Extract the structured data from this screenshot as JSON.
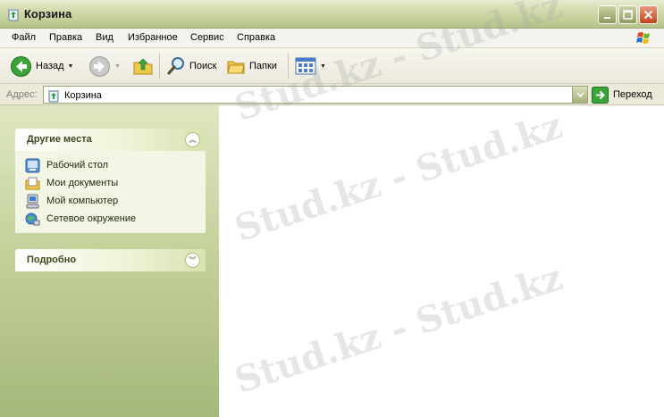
{
  "window": {
    "title": "Корзина",
    "accent_color": "#b5c28a"
  },
  "menu": {
    "items": [
      "Файл",
      "Правка",
      "Вид",
      "Избранное",
      "Сервис",
      "Справка"
    ]
  },
  "toolbar": {
    "back_label": "Назад",
    "search_label": "Поиск",
    "folders_label": "Папки"
  },
  "address": {
    "label": "Адрес:",
    "value": "Корзина",
    "go_label": "Переход"
  },
  "taskpane": {
    "other_places": {
      "title": "Другие места",
      "items": [
        {
          "label": "Рабочий стол",
          "icon": "desktop-icon"
        },
        {
          "label": "Мои документы",
          "icon": "my-documents-icon"
        },
        {
          "label": "Мой компьютер",
          "icon": "my-computer-icon"
        },
        {
          "label": "Сетевое окружение",
          "icon": "network-icon"
        }
      ]
    },
    "details": {
      "title": "Подробно"
    }
  },
  "watermark": {
    "text": "Stud.kz - Stud.kz"
  }
}
